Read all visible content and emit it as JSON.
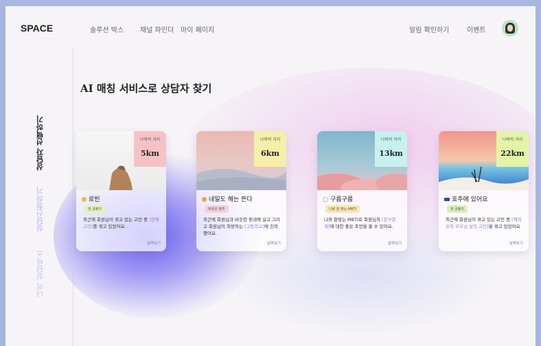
{
  "header": {
    "logo": "SPACE",
    "nav_left": [
      "솔루션 박스",
      "채널 파인더",
      "마이 페이지"
    ],
    "nav_right": [
      "알림 확인하기",
      "이벤트"
    ]
  },
  "sidebar": {
    "tabs": [
      {
        "label": "상담자 선택하기",
        "active": true
      },
      {
        "label": "상담신청하기",
        "active": false
      },
      {
        "label": "나의 상담박스",
        "active": false
      }
    ]
  },
  "main": {
    "title": "AI 매칭 서비스로 상담자 찾기",
    "cards": [
      {
        "distance_label": "나와의 거리",
        "distance": "5km",
        "dist_color": "#f6c2c8",
        "name": "로빈",
        "emoji_color": "#f0b93a",
        "badge": "전 공평지",
        "badge_color": "#e3f2b8",
        "desc_before": "최근에 회원님이 겪고 있는 고민 중 ",
        "desc_highlight": "(연애 고민)",
        "desc_after": "를 겪고 있었어요.",
        "more": "살펴보기"
      },
      {
        "distance_label": "나와의 거리",
        "distance": "6km",
        "dist_color": "#f4f0a8",
        "name": "내일도 해는 뜬다",
        "emoji_color": "#f2a63a",
        "badge": "따뜻한 말투",
        "badge_color": "#f7d0dc",
        "desc_before": "최근에 회원님과 비슷한 동네에 살고 그리고 회원님이 희망하는 ",
        "desc_highlight": "[고등학교]",
        "desc_after": "에 진학했어요.",
        "more": "살펴보기"
      },
      {
        "distance_label": "나와의 거리",
        "distance": "13km",
        "dist_color": "#c6f1ef",
        "name": "구름구름",
        "emoji_color": "#ffffff",
        "badge": "나랑 잘 맞는 MBTI",
        "badge_color": "#f8e6b0",
        "desc_before": "나와 잘맞는 MBTI로 회원님의 ",
        "desc_highlight": "[친구관계]",
        "desc_after": "에 대한 좋은 조언을 줄 수 있어요.",
        "more": "살펴보기"
      },
      {
        "distance_label": "나와의 거리",
        "distance": "22km",
        "dist_color": "#e4f4a6",
        "name": "호주에 있어요",
        "emoji_color": "#2c4ea0",
        "badge": "전 공평지",
        "badge_color": "#d9f0bc",
        "desc_before": "최근에 회원님이 겪고 있는 고민 중 ",
        "desc_highlight": "[해외 유학 부모님 설득 고민]",
        "desc_after": "을 겪고 있었어요",
        "more": "살펴보기"
      }
    ]
  }
}
